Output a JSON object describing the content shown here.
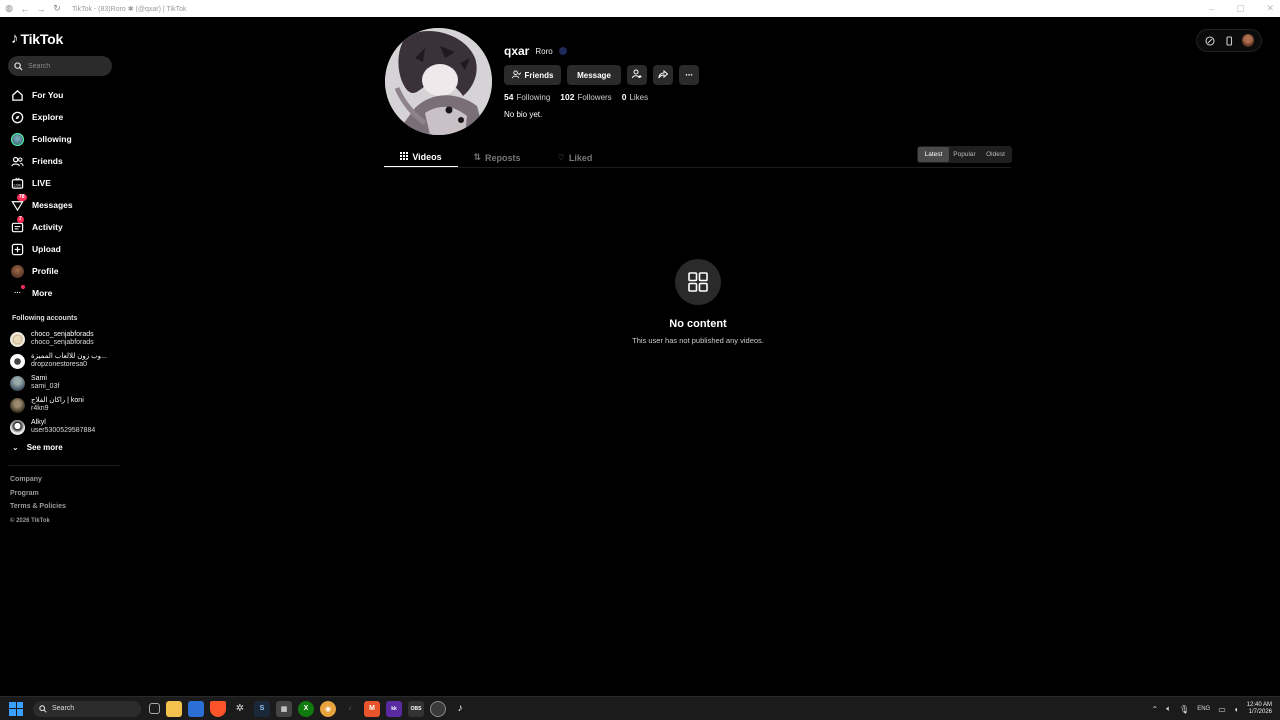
{
  "window": {
    "title": "TikTok - (83)Roro ✱ (@qxar) | TikTok"
  },
  "sidebar": {
    "logo_text": "TikTok",
    "search_placeholder": "Search",
    "nav": [
      {
        "label": "For You",
        "icon": "home-icon"
      },
      {
        "label": "Explore",
        "icon": "compass-icon"
      },
      {
        "label": "Following",
        "icon": "following-avatar-icon"
      },
      {
        "label": "Friends",
        "icon": "friends-icon"
      },
      {
        "label": "LIVE",
        "icon": "live-icon"
      },
      {
        "label": "Messages",
        "icon": "messages-icon",
        "badge": "78"
      },
      {
        "label": "Activity",
        "icon": "activity-icon",
        "badge": "7"
      },
      {
        "label": "Upload",
        "icon": "upload-icon"
      },
      {
        "label": "Profile",
        "icon": "profile-avatar-icon"
      },
      {
        "label": "More",
        "icon": "more-icon"
      }
    ],
    "following_title": "Following accounts",
    "following": [
      {
        "name": "choco_senjabforads",
        "handle": "choco_senjabforads"
      },
      {
        "name": "وب زون للالعاب المميزة...",
        "handle": "dropzonestoresa0"
      },
      {
        "name": "Sami",
        "handle": "sami_03f"
      },
      {
        "name": "راكان الفلاج | koni",
        "handle": "r4kn9"
      },
      {
        "name": "Alkyl",
        "handle": "user5300529587884"
      }
    ],
    "see_more": "See more",
    "footer": {
      "links": [
        "Company",
        "Program",
        "Terms & Policies"
      ],
      "copyright": "© 2026 TikTok"
    }
  },
  "profile": {
    "username": "qxar",
    "display_name": "Roro",
    "actions": {
      "friends": "Friends",
      "message": "Message"
    },
    "stats": {
      "following_count": "54",
      "following_label": "Following",
      "followers_count": "102",
      "followers_label": "Followers",
      "likes_count": "0",
      "likes_label": "Likes"
    },
    "bio": "No bio yet."
  },
  "tabs": [
    {
      "label": "Videos",
      "icon": "grid-icon",
      "active": true
    },
    {
      "label": "Reposts",
      "icon": "repost-icon",
      "active": false
    },
    {
      "label": "Liked",
      "icon": "heart-icon",
      "active": false
    }
  ],
  "sort": [
    {
      "label": "Latest",
      "active": true
    },
    {
      "label": "Popular",
      "active": false
    },
    {
      "label": "Oldest",
      "active": false
    }
  ],
  "empty_state": {
    "title": "No content",
    "subtitle": "This user has not published any videos."
  },
  "taskbar": {
    "search_label": "Search",
    "language": "ENG",
    "time": "12:40 AM",
    "date": "1/7/2026"
  },
  "colors": {
    "background": "#000000",
    "accent": "#fe2c55",
    "button": "#2a2a2a"
  }
}
